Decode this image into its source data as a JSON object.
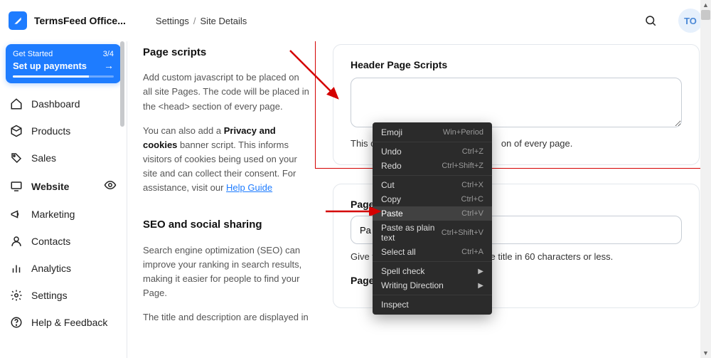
{
  "header": {
    "site_name": "TermsFeed Office...",
    "crumbs": [
      "Settings",
      "Site Details"
    ],
    "avatar": "TO"
  },
  "get_started": {
    "title": "Get Started",
    "progress": "3/4",
    "cta": "Set up payments"
  },
  "sidebar": {
    "items": [
      {
        "label": "Dashboard"
      },
      {
        "label": "Products"
      },
      {
        "label": "Sales"
      },
      {
        "label": "Website",
        "active": true,
        "preview": true
      },
      {
        "label": "Marketing"
      },
      {
        "label": "Contacts"
      },
      {
        "label": "Analytics"
      },
      {
        "label": "Settings"
      },
      {
        "label": "Help & Feedback"
      }
    ]
  },
  "page_scripts": {
    "heading": "Page scripts",
    "p1": "Add custom javascript to be placed on all site Pages. The code will be placed in the <head> section of every page.",
    "p2a": "You can also add a ",
    "p2b": "Privacy and cookies",
    "p2c": " banner script. This informs visitors of cookies being used on your site and can collect their consent. For assistance, visit our ",
    "p2link": "Help Guide"
  },
  "seo": {
    "heading": "SEO and social sharing",
    "p1": "Search engine optimization (SEO) can improve your ranking in search results, making it easier for people to find your Page.",
    "p2": "The title and description are displayed in"
  },
  "header_card": {
    "title": "Header Page Scripts",
    "help_full": "This code will be placed in the <head> section of every page.",
    "help_prefix": "This c",
    "help_suffix": "on of every page."
  },
  "seo_card": {
    "page_title_label": "Page title",
    "page_title_prefix": "Pa",
    "page_title_help": "Give the Page a clear and accurate title in 60 characters or less.",
    "page_desc_label": "Page description"
  },
  "context_menu": {
    "items": [
      {
        "label": "Emoji",
        "sc": "Win+Period"
      },
      {
        "sep": true
      },
      {
        "label": "Undo",
        "sc": "Ctrl+Z"
      },
      {
        "label": "Redo",
        "sc": "Ctrl+Shift+Z"
      },
      {
        "sep": true
      },
      {
        "label": "Cut",
        "sc": "Ctrl+X"
      },
      {
        "label": "Copy",
        "sc": "Ctrl+C"
      },
      {
        "label": "Paste",
        "sc": "Ctrl+V",
        "hi": true
      },
      {
        "label": "Paste as plain text",
        "sc": "Ctrl+Shift+V"
      },
      {
        "label": "Select all",
        "sc": "Ctrl+A"
      },
      {
        "sep": true
      },
      {
        "label": "Spell check",
        "sub": true
      },
      {
        "label": "Writing Direction",
        "sub": true
      },
      {
        "sep": true
      },
      {
        "label": "Inspect"
      }
    ]
  }
}
